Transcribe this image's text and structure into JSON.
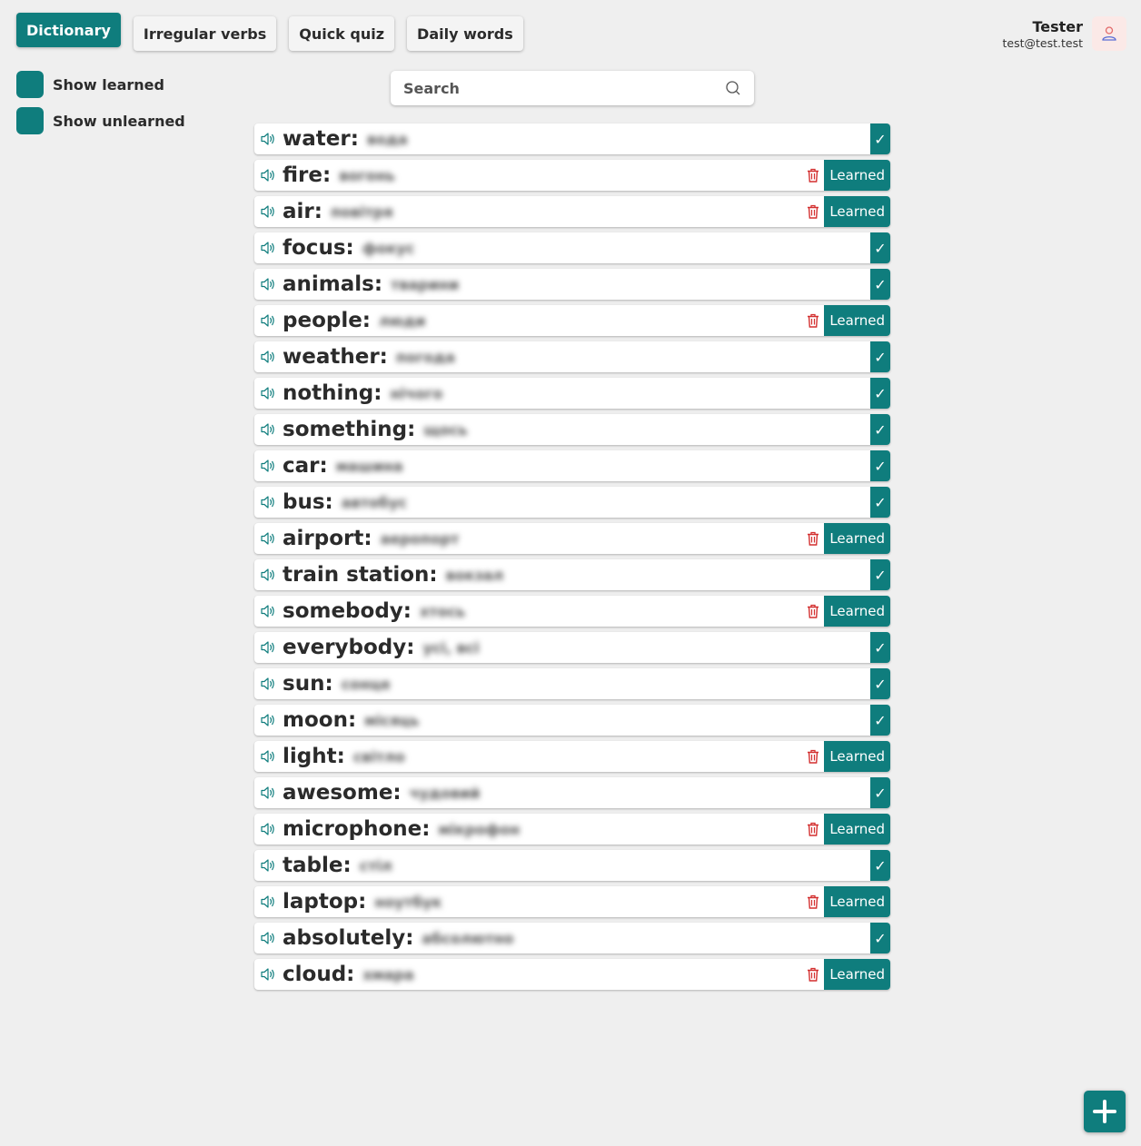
{
  "nav": {
    "tabs": [
      {
        "label": "Dictionary",
        "active": true
      },
      {
        "label": "Irregular verbs",
        "active": false
      },
      {
        "label": "Quick quiz",
        "active": false
      },
      {
        "label": "Daily words",
        "active": false
      }
    ]
  },
  "user": {
    "name": "Tester",
    "email": "test@test.test",
    "icon": "user-icon"
  },
  "filters": [
    {
      "label": "Show learned"
    },
    {
      "label": "Show unlearned"
    }
  ],
  "search": {
    "placeholder": "Search",
    "value": "",
    "icon": "search-icon"
  },
  "colors": {
    "accent": "#0f7d7d",
    "delete": "#d32f2f",
    "background": "#efefef"
  },
  "learned_label": "Learned",
  "check_mark": "✓",
  "words": [
    {
      "word": "water:",
      "translation": "вода",
      "learned": false
    },
    {
      "word": "fire:",
      "translation": "вогонь",
      "learned": true
    },
    {
      "word": "air:",
      "translation": "повітря",
      "learned": true
    },
    {
      "word": "focus:",
      "translation": "фокус",
      "learned": false
    },
    {
      "word": "animals:",
      "translation": "тварини",
      "learned": false
    },
    {
      "word": "people:",
      "translation": "люди",
      "learned": true
    },
    {
      "word": "weather:",
      "translation": "погода",
      "learned": false
    },
    {
      "word": "nothing:",
      "translation": "нічого",
      "learned": false
    },
    {
      "word": "something:",
      "translation": "щось",
      "learned": false
    },
    {
      "word": "car:",
      "translation": "машина",
      "learned": false
    },
    {
      "word": "bus:",
      "translation": "автобус",
      "learned": false
    },
    {
      "word": "airport:",
      "translation": "аеропорт",
      "learned": true
    },
    {
      "word": "train station:",
      "translation": "вокзал",
      "learned": false
    },
    {
      "word": "somebody:",
      "translation": "хтось",
      "learned": true
    },
    {
      "word": "everybody:",
      "translation": "усі, всі",
      "learned": false
    },
    {
      "word": "sun:",
      "translation": "сонце",
      "learned": false
    },
    {
      "word": "moon:",
      "translation": "місяць",
      "learned": false
    },
    {
      "word": "light:",
      "translation": "світло",
      "learned": true
    },
    {
      "word": "awesome:",
      "translation": "чудовий",
      "learned": false
    },
    {
      "word": "microphone:",
      "translation": "мікрофон",
      "learned": true
    },
    {
      "word": "table:",
      "translation": "стіл",
      "learned": false
    },
    {
      "word": "laptop:",
      "translation": "ноутбук",
      "learned": true
    },
    {
      "word": "absolutely:",
      "translation": "абсолютно",
      "learned": false
    },
    {
      "word": "cloud:",
      "translation": "хмара",
      "learned": true
    }
  ],
  "fab": {
    "icon": "plus-icon"
  }
}
